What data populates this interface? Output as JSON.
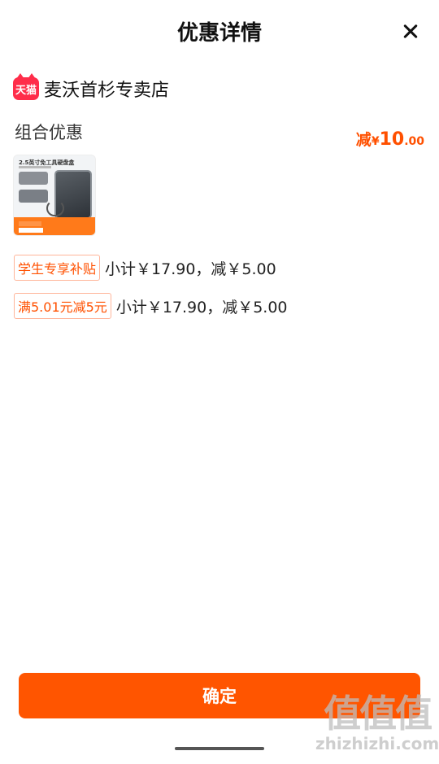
{
  "header": {
    "title": "优惠详情",
    "close_icon": "close-icon"
  },
  "store": {
    "badge_icon": "tmall-icon",
    "badge_text": "天猫",
    "name": "麦沃首杉专卖店"
  },
  "section": {
    "title": "组合优惠",
    "discount": {
      "prefix": "减",
      "currency": "¥",
      "integer": "10",
      "decimal": ".00"
    }
  },
  "product": {
    "thumbnail_title": "2.5英寸免工具硬盘盒"
  },
  "promos": [
    {
      "tag": "学生专享补贴",
      "text": "小计￥17.90，减￥5.00"
    },
    {
      "tag": "满5.01元减5元",
      "text": "小计￥17.90，减￥5.00"
    }
  ],
  "footer": {
    "confirm_label": "确定"
  },
  "watermark": {
    "main": "值值值",
    "sub": "zhizhizhi.com"
  },
  "colors": {
    "accent": "#ff5000",
    "button": "#ff5500",
    "tmall": "#ff2d4a"
  }
}
